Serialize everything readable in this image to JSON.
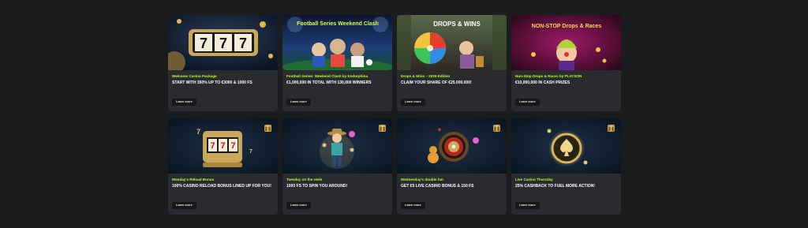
{
  "promotions": [
    {
      "tag": "Welcome Casino Package",
      "title": "START WITH 350% UP TO €3000 & 1000 FS",
      "button": "Learn more",
      "banner_icon": "slot-777-icon",
      "banner_colors": [
        "#0e1a2e",
        "#2a3b57"
      ]
    },
    {
      "tag": "Football Series: Weekend Clash by Endorphina",
      "title": "€1,000,000 IN TOTAL WITH 130,000 WINNERS",
      "button": "Learn more",
      "banner_text": "Football Series Weekend Clash",
      "banner_icon": "football-players-icon",
      "banner_colors": [
        "#0c1b3a",
        "#1d3f7a"
      ]
    },
    {
      "tag": "Drops & Wins – 2026 Edition",
      "title": "CLAIM YOUR SHARE OF €25.000.000!",
      "button": "Learn more",
      "banner_text": "DROPS & WINS",
      "banner_icon": "wheel-icon",
      "banner_colors": [
        "#3a4a2e",
        "#6b6f52"
      ]
    },
    {
      "tag": "Non-Stop Drops & Races by PLAYSON",
      "title": "€10,000,000 IN CASH PRIZES",
      "button": "Learn more",
      "banner_text": "NON-STOP Drops & Races",
      "banner_icon": "clown-icon",
      "banner_colors": [
        "#3a0c26",
        "#7a1450"
      ]
    },
    {
      "tag": "Monday's Reload Bonus",
      "title": "100% CASINO RELOAD BONUS LINED UP FOR YOU!",
      "button": "Learn more",
      "banner_icon": "slot-machine-icon",
      "banner_colors": [
        "#0c1828",
        "#1c3046"
      ]
    },
    {
      "tag": "Tuesday on the reels",
      "title": "1000 FS TO SPIN YOU AROUND!",
      "button": "Learn more",
      "banner_icon": "cowboy-icon",
      "banner_colors": [
        "#0c1828",
        "#1c3046"
      ]
    },
    {
      "tag": "Wednesday's double fun",
      "title": "GET €5 LIVE CASINO BONUS & 150 FS",
      "button": "Learn more",
      "banner_icon": "roulette-icon",
      "banner_colors": [
        "#0c1828",
        "#1c3046"
      ]
    },
    {
      "tag": "Live Casino Thursday",
      "title": "25% CASHBACK TO FUEL MORE ACTION!",
      "button": "Learn more",
      "banner_icon": "spade-chip-icon",
      "banner_colors": [
        "#0c1828",
        "#1c3046"
      ]
    }
  ],
  "colors": {
    "accent": "#c6f432",
    "card_bg": "#2a2b2e",
    "page_bg": "#1b1c1e",
    "button_bg": "#17181a"
  }
}
